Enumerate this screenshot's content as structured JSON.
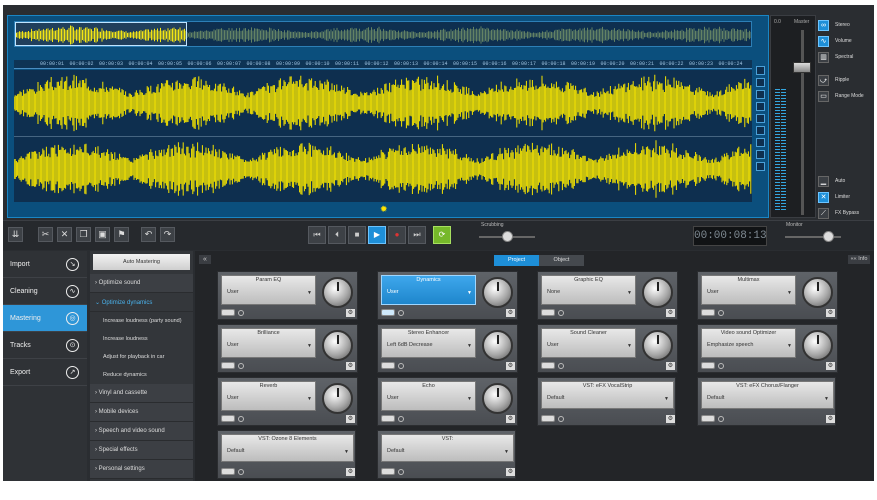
{
  "waveform": {
    "ruler_labels": [
      "00:00:01",
      "00:00:02",
      "00:00:03",
      "00:00:04",
      "00:00:05",
      "00:00:06",
      "00:00:07",
      "00:00:08",
      "00:00:09",
      "00:00:10",
      "00:00:11",
      "00:00:12",
      "00:00:13",
      "00:00:14",
      "00:00:15",
      "00:00:16",
      "00:00:17",
      "00:00:18",
      "00:00:19",
      "00:00:20",
      "00:00:21",
      "00:00:22",
      "00:00:23",
      "00:00:24"
    ],
    "wave_color": "#f5e400",
    "background_color": "#0e2f4f"
  },
  "meter": {
    "left_label": "0.0",
    "master_label": "Master"
  },
  "view_modes": [
    {
      "label": "Stereo",
      "icon": "stereo-icon",
      "active": true
    },
    {
      "label": "Volume",
      "icon": "volume-icon",
      "active": true
    },
    {
      "label": "Spectral",
      "icon": "spectral-icon",
      "active": false
    },
    {
      "label": "Ripple",
      "icon": "ripple-icon",
      "active": false
    },
    {
      "label": "Range Mode",
      "icon": "range-mode-icon",
      "active": false
    }
  ],
  "bottom_modes": [
    {
      "label": "Auto",
      "icon": "auto-icon",
      "active": false
    },
    {
      "label": "Limiter",
      "icon": "limiter-icon",
      "active": true
    },
    {
      "label": "FX Bypass",
      "icon": "fx-bypass-icon",
      "active": false
    }
  ],
  "transport": {
    "time": "00:00:08:13",
    "scrubbing_label": "Scrubbing",
    "monitor_label": "Monitor"
  },
  "nav": [
    {
      "label": "Import",
      "icon": "import-icon",
      "active": false
    },
    {
      "label": "Cleaning",
      "icon": "cleaning-icon",
      "active": false
    },
    {
      "label": "Mastering",
      "icon": "mastering-icon",
      "active": true
    },
    {
      "label": "Tracks",
      "icon": "tracks-icon",
      "active": false
    },
    {
      "label": "Export",
      "icon": "export-icon",
      "active": false
    }
  ],
  "sub_panel": {
    "auto_mastering": "Auto Mastering",
    "items": [
      {
        "label": "› Optimize sound",
        "open": false
      },
      {
        "label": "⌄ Optimize dynamics",
        "open": true
      }
    ],
    "children": [
      "Increase loudness (party sound)",
      "Increase loudness",
      "Adjust for playback in car",
      "Reduce dynamics"
    ],
    "more": [
      "› Vinyl and cassette",
      "› Mobile devices",
      "› Speech and video sound",
      "› Special effects",
      "› Personal settings"
    ]
  },
  "fx_panel": {
    "tabs": [
      "Project",
      "Object"
    ],
    "active_tab": "Project",
    "info_label": "«« Info",
    "collapse_label": "«"
  },
  "effects": [
    {
      "name": "Param EQ",
      "preset": "User",
      "selected": false
    },
    {
      "name": "Dynamics",
      "preset": "User",
      "selected": true
    },
    {
      "name": "Graphic EQ",
      "preset": "None",
      "selected": false
    },
    {
      "name": "Multimax",
      "preset": "User",
      "selected": false
    },
    {
      "name": "Brilliance",
      "preset": "User",
      "selected": false
    },
    {
      "name": "Stereo Enhancer",
      "preset": "Left 6dB Decrease",
      "selected": false
    },
    {
      "name": "Sound Cleaner",
      "preset": "User",
      "selected": false
    },
    {
      "name": "Video sound Optimizer",
      "preset": "Emphasize speech",
      "selected": false
    },
    {
      "name": "Reverb",
      "preset": "User",
      "selected": false
    },
    {
      "name": "Echo",
      "preset": "User",
      "selected": false
    },
    {
      "name": "VST: eFX VocalStrip",
      "preset": "Default",
      "selected": false
    },
    {
      "name": "VST: eFX Chorus/Flanger",
      "preset": "Default",
      "selected": false
    },
    {
      "name": "VST: Ozone 8 Elements",
      "preset": "Default",
      "selected": false
    },
    {
      "name": "VST:",
      "preset": "Default",
      "selected": false
    }
  ]
}
